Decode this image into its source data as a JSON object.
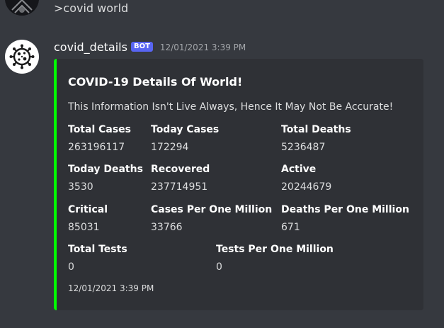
{
  "previous_message": {
    "text": ">covid world"
  },
  "message": {
    "username": "covid_details",
    "bot_tag": "BOT",
    "timestamp": "12/01/2021 3:39 PM",
    "avatar_icon": "virus-icon"
  },
  "embed": {
    "accent_color": "#00ff00",
    "title": "COVID-19 Details Of World!",
    "description": "This Information Isn't Live Always, Hence It May Not Be Accurate!",
    "fields": [
      {
        "name": "Total Cases",
        "value": "263196117"
      },
      {
        "name": "Today Cases",
        "value": "172294"
      },
      {
        "name": "Total Deaths",
        "value": "5236487"
      },
      {
        "name": "Today Deaths",
        "value": "3530"
      },
      {
        "name": "Recovered",
        "value": "237714951"
      },
      {
        "name": "Active",
        "value": "20244679"
      },
      {
        "name": "Critical",
        "value": "85031"
      },
      {
        "name": "Cases Per One Million",
        "value": "33766"
      },
      {
        "name": "Deaths Per One Million",
        "value": "671"
      },
      {
        "name": "Total Tests",
        "value": "0"
      },
      {
        "name": "Tests Per One Million",
        "value": "0"
      }
    ],
    "footer": "12/01/2021 3:39 PM"
  }
}
